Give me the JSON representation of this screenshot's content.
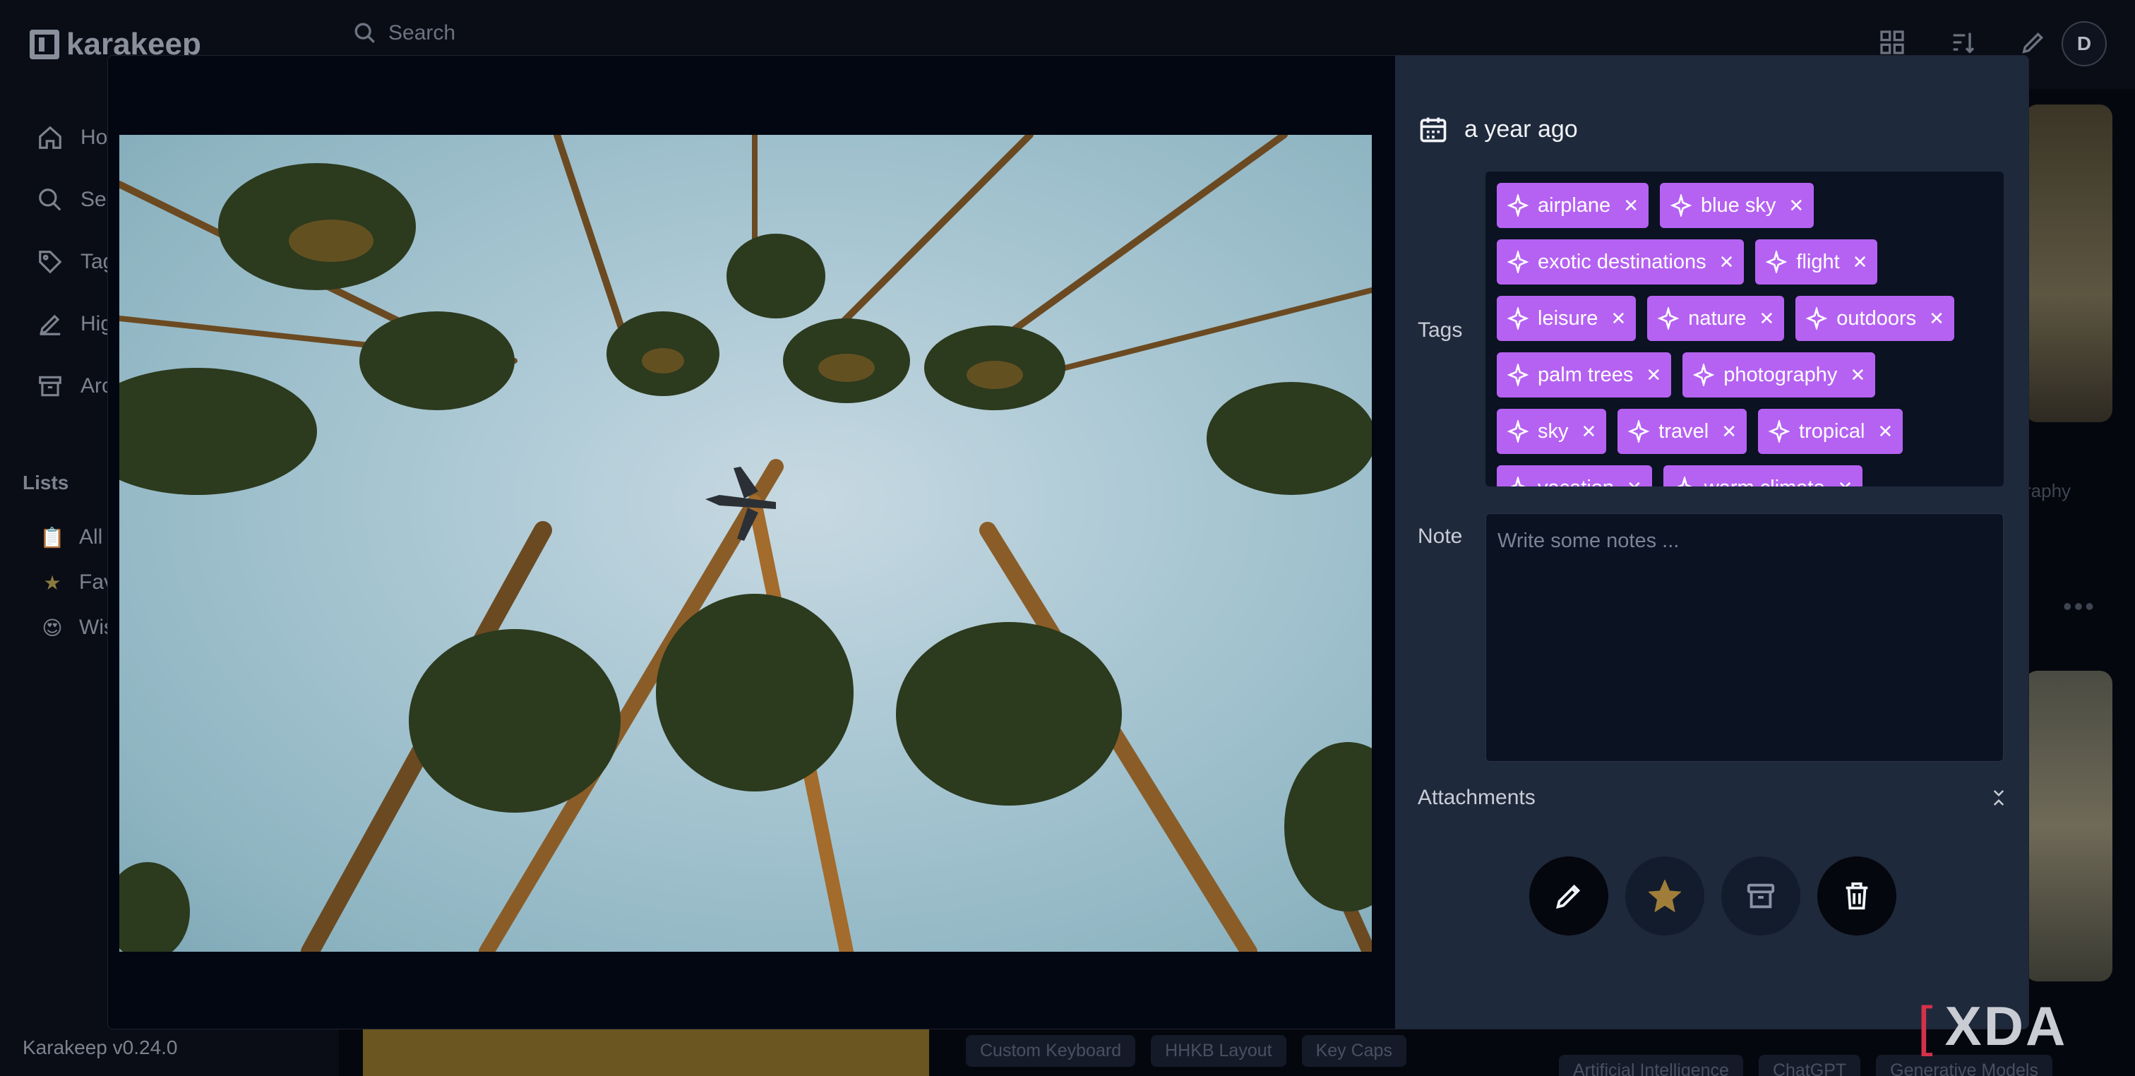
{
  "app": {
    "logo_text": "karakeep",
    "nav": [
      {
        "label": "Hor",
        "icon": "home-icon"
      },
      {
        "label": "Sea",
        "icon": "search-icon"
      },
      {
        "label": "Tag",
        "icon": "tag-icon"
      },
      {
        "label": "Hig",
        "icon": "highlighter-icon"
      },
      {
        "label": "Arc",
        "icon": "archive-icon"
      }
    ],
    "lists_heading": "Lists",
    "lists": [
      {
        "label": "All",
        "icon": "clipboard-icon"
      },
      {
        "label": "Fav",
        "icon": "star-icon"
      },
      {
        "label": "Wis",
        "icon": "emoji-face-icon"
      }
    ],
    "version": "Karakeep v0.24.0",
    "search_placeholder": "Search",
    "avatar_initial": "D",
    "bg_right_chip": "raphy",
    "bg_tags": [
      "Custom Keyboard",
      "HHKB Layout",
      "Key Caps"
    ],
    "bg_tags_right": [
      "Artificial Intelligence",
      "ChatGPT",
      "Generative Models"
    ]
  },
  "modal": {
    "date": "a year ago",
    "tags_label": "Tags",
    "tags": [
      "airplane",
      "blue sky",
      "exotic destinations",
      "flight",
      "leisure",
      "nature",
      "outdoors",
      "palm trees",
      "photography",
      "sky",
      "travel",
      "tropical",
      "vacation",
      "warm climate"
    ],
    "note_label": "Note",
    "note_placeholder": "Write some notes ...",
    "attachments_label": "Attachments",
    "actions": [
      "edit",
      "favourite",
      "archive",
      "delete"
    ]
  },
  "watermark": {
    "brand": "XDA"
  },
  "colors": {
    "tag_bg": "#b562f2",
    "panel_bg": "#1e293b",
    "favourite_star": "#a07e3a"
  }
}
